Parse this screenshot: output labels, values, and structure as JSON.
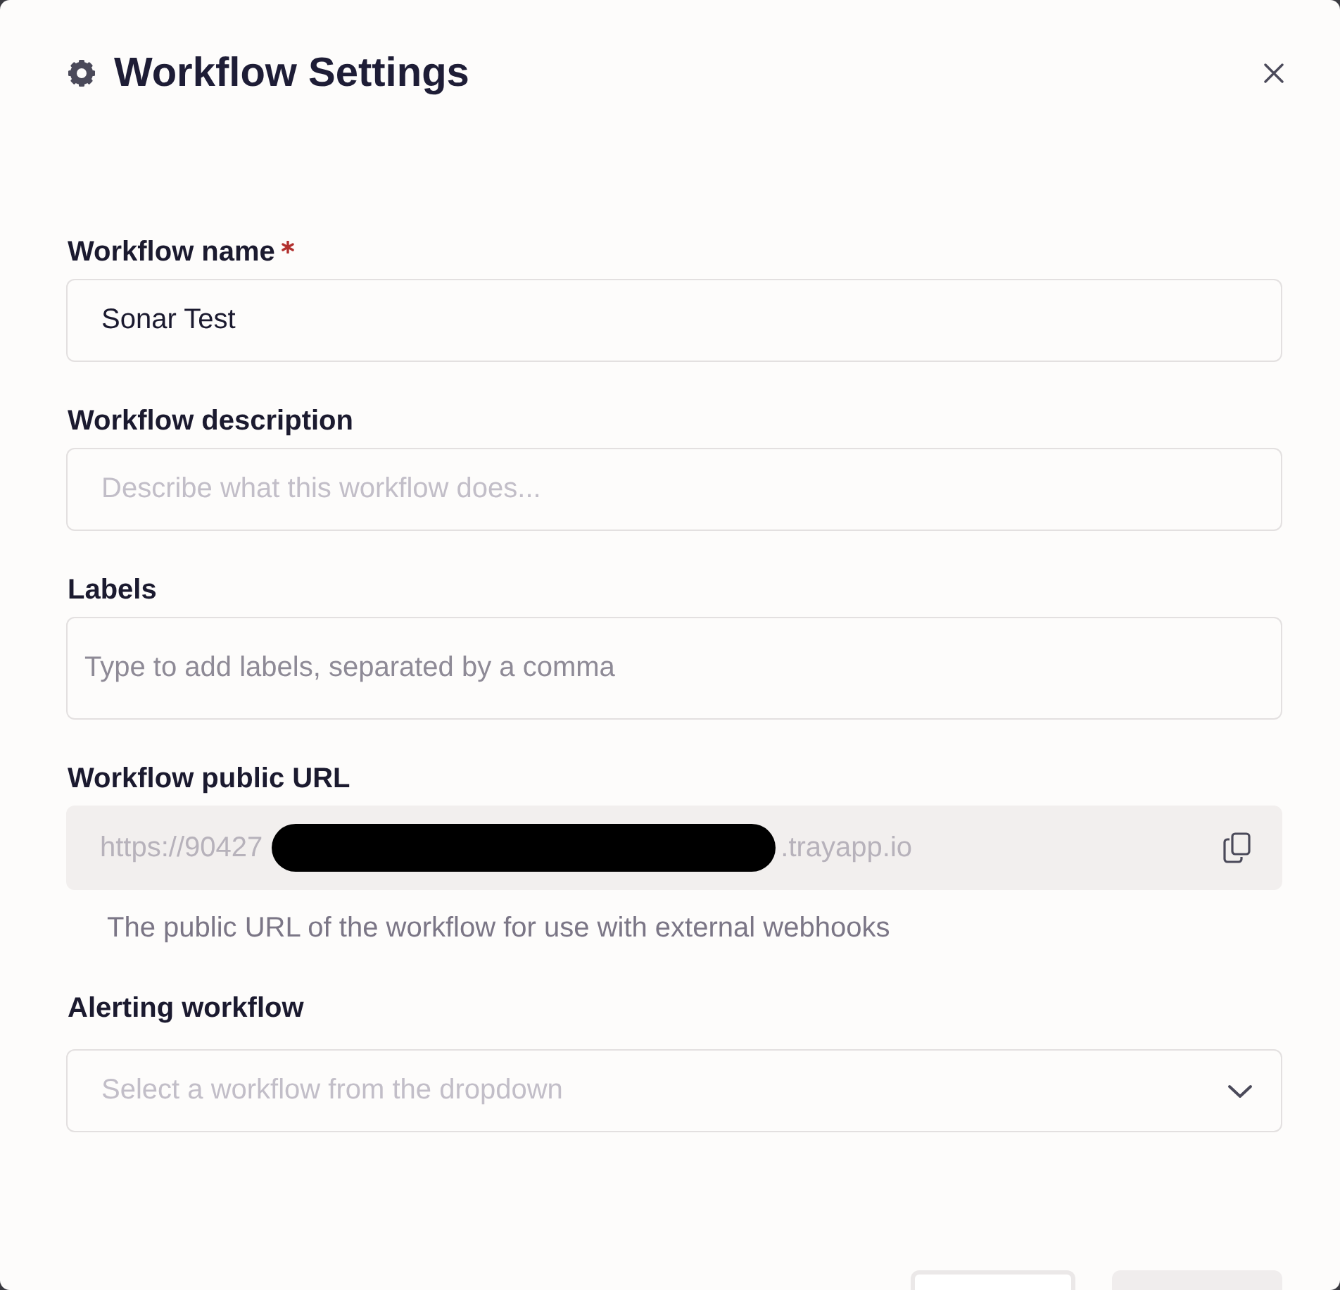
{
  "dialog": {
    "title": "Workflow Settings"
  },
  "fields": [
    {
      "kind": "text",
      "label": "Workflow name",
      "required": true,
      "value": "Sonar Test"
    },
    {
      "kind": "text",
      "label": "Workflow description",
      "required": false,
      "placeholder": "Describe what this workflow does..."
    },
    {
      "kind": "tags",
      "label": "Labels",
      "required": false,
      "placeholder": "Type to add labels, separated by a comma"
    },
    {
      "kind": "url",
      "label": "Workflow public URL",
      "required": false,
      "value_start": "https://90427",
      "value_end": ".trayapp.io",
      "redacted": true,
      "help": "The public URL of the workflow for use with external webhooks"
    },
    {
      "kind": "select",
      "label": "Alerting workflow",
      "required": false,
      "placeholder": "Select a workflow from the dropdown"
    }
  ],
  "footer": {
    "buttons": [
      {
        "kind": "outlined"
      },
      {
        "kind": "filled"
      }
    ]
  }
}
